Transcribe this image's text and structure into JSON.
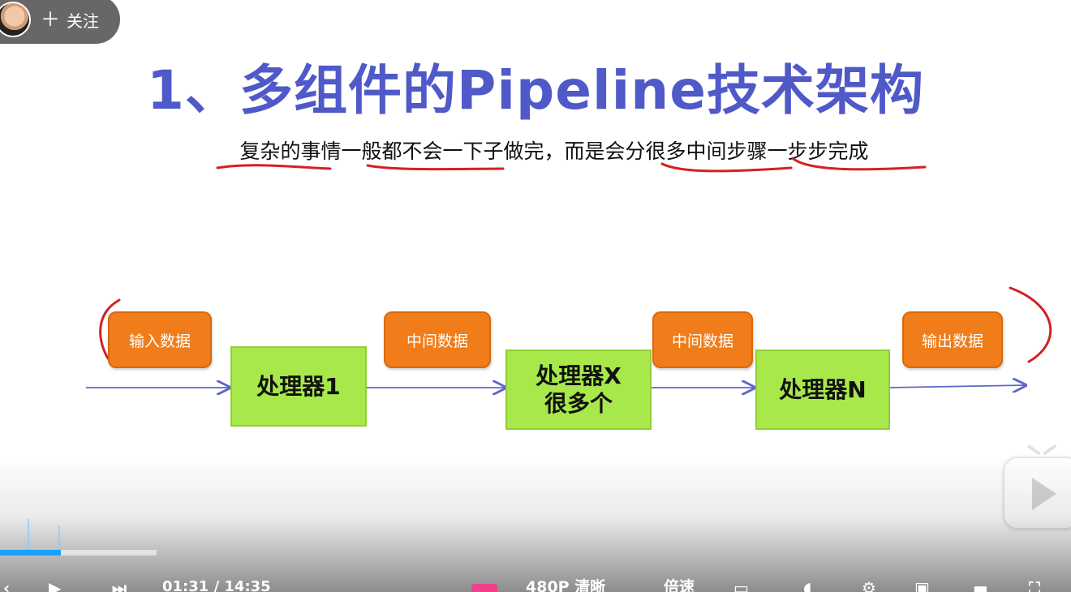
{
  "follow": {
    "plus": "＋",
    "label": "关注"
  },
  "slide": {
    "title": "1、多组件的Pipeline技术架构",
    "subtitle": "复杂的事情一般都不会一下子做完，而是会分很多中间步骤一步步完成",
    "data_labels": {
      "input": "输入数据",
      "middle1": "中间数据",
      "middle2": "中间数据",
      "output": "输出数据"
    },
    "processors": {
      "p1": "处理器1",
      "px_line1": "处理器X",
      "px_line2": "很多个",
      "pn": "处理器N"
    }
  },
  "player": {
    "progress_fraction": 0.39,
    "time_text": "01:31 / 14:35",
    "quality_label": "480P 清晰",
    "speed_label": "倍速"
  },
  "colors": {
    "title": "#4f59c8",
    "data_box": "#f07d1a",
    "processor_box": "#a8e84a",
    "arrow": "#5f66c9",
    "annotation": "#d62020",
    "progress": "#1ea0ff"
  }
}
